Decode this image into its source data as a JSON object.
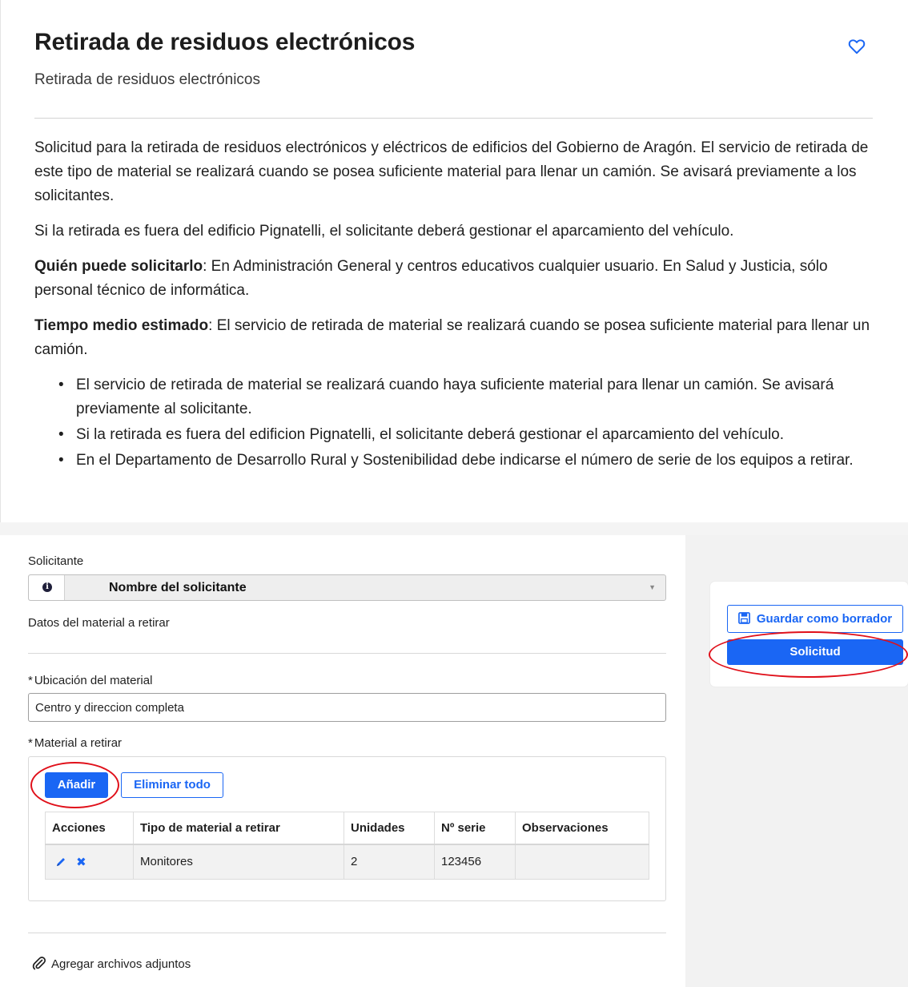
{
  "header": {
    "title": "Retirada de residuos electrónicos",
    "subtitle": "Retirada de residuos electrónicos"
  },
  "description": {
    "paragraph1": "Solicitud para la retirada de residuos electrónicos y eléctricos de edificios del Gobierno de Aragón. El servicio de retirada de este tipo de material se realizará cuando se posea suficiente material para llenar un camión. Se avisará previamente a los solicitantes.",
    "paragraph2": "Si la retirada es fuera del edificio Pignatelli, el solicitante deberá gestionar el aparcamiento del vehículo.",
    "who_label": "Quién puede solicitarlo",
    "who_text": ": En Administración General y centros educativos cualquier usuario. En Salud y Justicia, sólo personal técnico de informática.",
    "time_label": "Tiempo medio estimado",
    "time_text": ": El servicio de retirada de material se realizará cuando se posea suficiente material para llenar un camión.",
    "bullets": [
      "El servicio de retirada de material se realizará cuando haya suficiente material para llenar un camión. Se avisará previamente al solicitante.",
      "Si la retirada es fuera del edificion Pignatelli, el solicitante deberá gestionar el aparcamiento del vehículo.",
      "En el Departamento de Desarrollo Rural y Sostenibilidad debe indicarse el número de serie de los equipos a retirar."
    ]
  },
  "form": {
    "applicant_label": "Solicitante",
    "applicant_value": "Nombre del solicitante",
    "section_label": "Datos del material a retirar",
    "location_label": "Ubicación del material",
    "location_value": "Centro y direccion completa",
    "material_label": "Material a retirar",
    "required_mark": "*",
    "add_button": "Añadir",
    "clear_button": "Eliminar todo",
    "table": {
      "headers": [
        "Acciones",
        "Tipo de material a retirar",
        "Unidades",
        "Nº serie",
        "Observaciones"
      ],
      "rows": [
        {
          "type": "Monitores",
          "units": "2",
          "serial": "123456",
          "notes": ""
        }
      ]
    },
    "attach_label": "Agregar archivos adjuntos"
  },
  "actions": {
    "draft_button": "Guardar como borrador",
    "submit_button": "Solicitud"
  },
  "colors": {
    "accent": "#1a66f4",
    "annotation": "#e0101a"
  }
}
